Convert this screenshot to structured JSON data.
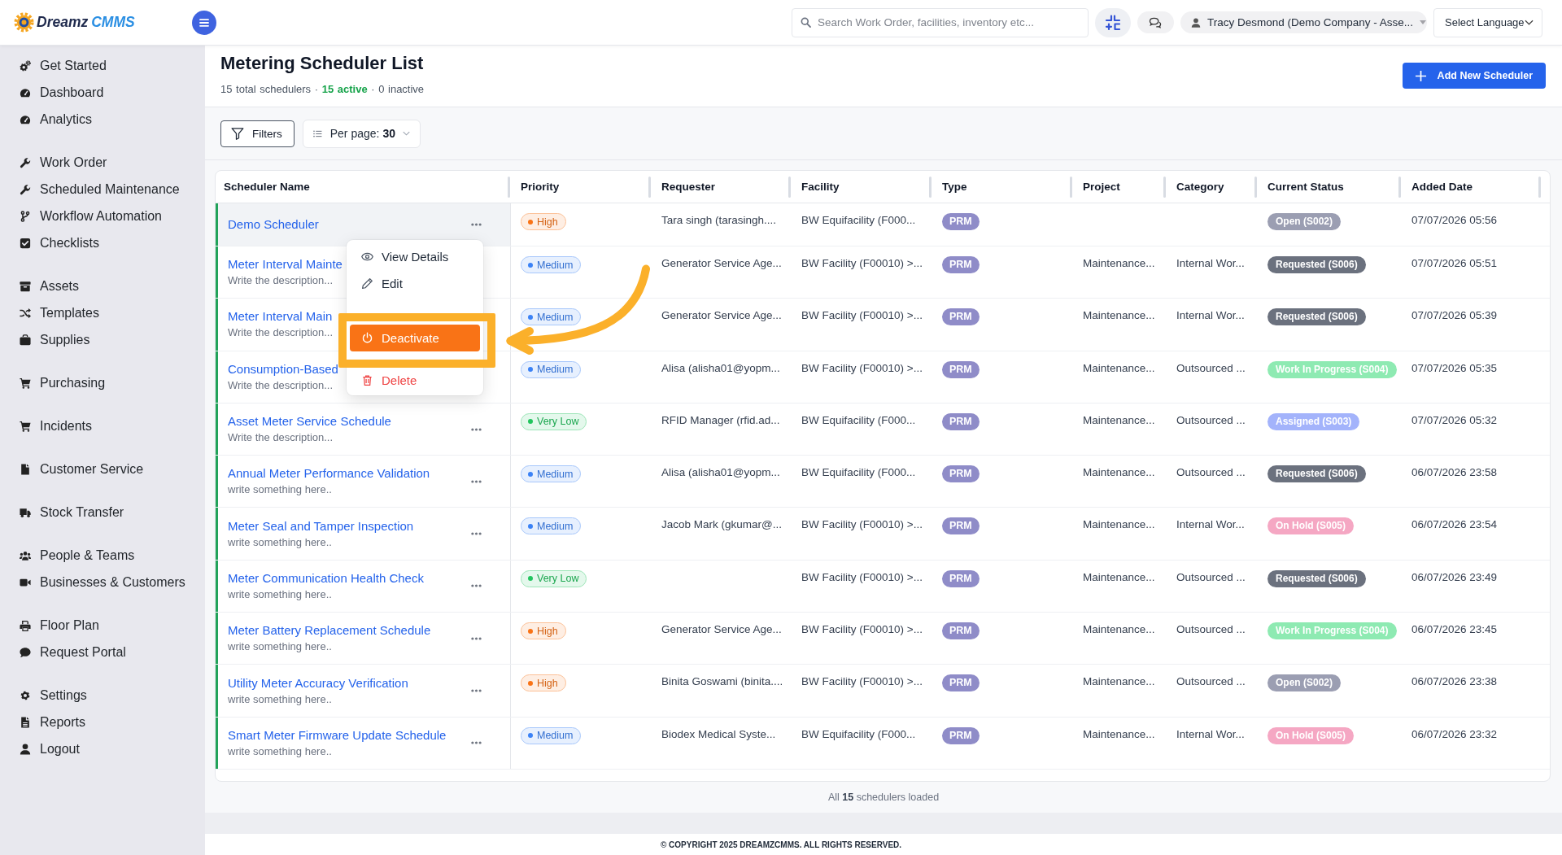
{
  "topbar": {
    "logo": {
      "text": "Dreamz",
      "accent": "CMMS"
    },
    "search": {
      "placeholder": "Search Work Order, facilities, inventory etc..."
    },
    "user": {
      "name": "Tracy Desmond (Demo Company - Asse..."
    },
    "language": {
      "label": "Select Language"
    }
  },
  "sidebar": {
    "groups": [
      {
        "items": [
          {
            "label": "Get Started"
          },
          {
            "label": "Dashboard"
          },
          {
            "label": "Analytics"
          }
        ]
      },
      {
        "items": [
          {
            "label": "Work Order"
          },
          {
            "label": "Scheduled Maintenance"
          },
          {
            "label": "Workflow Automation"
          },
          {
            "label": "Checklists"
          }
        ]
      },
      {
        "items": [
          {
            "label": "Assets"
          },
          {
            "label": "Templates"
          },
          {
            "label": "Supplies"
          }
        ]
      },
      {
        "items": [
          {
            "label": "Purchasing"
          }
        ]
      },
      {
        "items": [
          {
            "label": "Incidents"
          }
        ]
      },
      {
        "items": [
          {
            "label": "Customer Service"
          }
        ]
      },
      {
        "items": [
          {
            "label": "Stock Transfer"
          }
        ]
      },
      {
        "items": [
          {
            "label": "People & Teams"
          },
          {
            "label": "Businesses & Customers"
          }
        ]
      },
      {
        "items": [
          {
            "label": "Floor Plan"
          },
          {
            "label": "Request Portal"
          }
        ]
      },
      {
        "items": [
          {
            "label": "Settings"
          },
          {
            "label": "Reports"
          },
          {
            "label": "Logout"
          }
        ]
      }
    ]
  },
  "page": {
    "title": "Metering Scheduler List",
    "summary": "15 total schedulers · **15 active** · 0 inactive",
    "add_button": "Add New Scheduler"
  },
  "toolbar": {
    "filters": "Filters",
    "per_page": {
      "label": "Per page:",
      "value": "30"
    }
  },
  "table": {
    "columns": [
      "Scheduler Name",
      "Priority",
      "Requester",
      "Facility",
      "Type",
      "Project",
      "Category",
      "Current Status",
      "Added Date"
    ],
    "rows": [
      {
        "name": "Demo Scheduler",
        "active": true,
        "selected": true,
        "more_button": true,
        "priority": {
          "label": "High",
          "color": "#f97316"
        },
        "requester": "Tara singh (tarasingh....",
        "facility": "BW Equifacility (F000...",
        "type": "PRM",
        "status": {
          "label": "Open (S002)",
          "color": "#9b9eb2"
        },
        "added": "07/07/2026 05:56"
      },
      {
        "name": "Meter Interval Mainte",
        "description": "Write the description...",
        "active": true,
        "selected": false,
        "more_button": false,
        "priority": {
          "label": "Medium",
          "color": "#3b82f6"
        },
        "requester": "Generator Service Age...",
        "facility": "BW Facility (F00010) >...",
        "type": "PRM",
        "project": "Maintenance...",
        "category": "Internal Wor...",
        "status": {
          "label": "Requested (S006)",
          "color": "#6b717e"
        },
        "added": "07/07/2026 05:51"
      },
      {
        "name": "Meter Interval Main",
        "description": "Write the description...",
        "active": true,
        "selected": false,
        "more_button": false,
        "priority": {
          "label": "Medium",
          "color": "#3b82f6"
        },
        "requester": "Generator Service Age...",
        "facility": "BW Facility (F00010) >...",
        "type": "PRM",
        "project": "Maintenance...",
        "category": "Internal Wor...",
        "status": {
          "label": "Requested (S006)",
          "color": "#6b717e"
        },
        "added": "07/07/2026 05:39"
      },
      {
        "name": "Consumption-Based",
        "description": "Write the description...",
        "active": true,
        "selected": false,
        "more_button": false,
        "priority": {
          "label": "Medium",
          "color": "#3b82f6"
        },
        "requester": "Alisa (alisha01@yopm...",
        "facility": "BW Facility (F00010) >...",
        "type": "PRM",
        "project": "Maintenance...",
        "category": "Outsourced ...",
        "status": {
          "label": "Work In Progress (S004)",
          "color": "#8eeab2"
        },
        "added": "07/07/2026 05:35"
      },
      {
        "name": "Asset Meter Service Schedule",
        "description": "Write the description...",
        "active": true,
        "selected": false,
        "more_button": true,
        "priority": {
          "label": "Very Low",
          "color": "#22c55e"
        },
        "requester": "RFID Manager (rfid.ad...",
        "facility": "BW Equifacility (F000...",
        "type": "PRM",
        "project": "Maintenance...",
        "category": "Outsourced ...",
        "status": {
          "label": "Assigned (S003)",
          "color": "#a3b3fb"
        },
        "added": "07/07/2026 05:32"
      },
      {
        "name": "Annual Meter Performance Validation",
        "description": "write something here..",
        "active": true,
        "selected": false,
        "more_button": true,
        "priority": {
          "label": "Medium",
          "color": "#3b82f6"
        },
        "requester": "Alisa (alisha01@yopm...",
        "facility": "BW Equifacility (F000...",
        "type": "PRM",
        "project": "Maintenance...",
        "category": "Outsourced ...",
        "status": {
          "label": "Requested (S006)",
          "color": "#6b717e"
        },
        "added": "06/07/2026 23:58"
      },
      {
        "name": "Meter Seal and Tamper Inspection",
        "description": "write something here..",
        "active": true,
        "selected": false,
        "more_button": true,
        "priority": {
          "label": "Medium",
          "color": "#3b82f6"
        },
        "requester": "Jacob Mark (gkumar@...",
        "facility": "BW Facility (F00010) >...",
        "type": "PRM",
        "project": "Maintenance...",
        "category": "Internal Wor...",
        "status": {
          "label": "On Hold (S005)",
          "color": "#f5a7c3"
        },
        "added": "06/07/2026 23:54"
      },
      {
        "name": "Meter Communication Health Check",
        "description": "write something here..",
        "active": true,
        "selected": false,
        "more_button": true,
        "priority": {
          "label": "Very Low",
          "color": "#22c55e"
        },
        "facility": "BW Facility (F00010) >...",
        "type": "PRM",
        "project": "Maintenance...",
        "category": "Outsourced ...",
        "status": {
          "label": "Requested (S006)",
          "color": "#6b717e"
        },
        "added": "06/07/2026 23:49"
      },
      {
        "name": "Meter Battery Replacement Schedule",
        "description": "write something here..",
        "active": true,
        "selected": false,
        "more_button": true,
        "priority": {
          "label": "High",
          "color": "#f97316"
        },
        "requester": "Generator Service Age...",
        "facility": "BW Facility (F00010) >...",
        "type": "PRM",
        "project": "Maintenance...",
        "category": "Outsourced ...",
        "status": {
          "label": "Work In Progress (S004)",
          "color": "#8eeab2"
        },
        "added": "06/07/2026 23:45"
      },
      {
        "name": "Utility Meter Accuracy Verification",
        "description": "write something here..",
        "active": true,
        "selected": false,
        "more_button": true,
        "priority": {
          "label": "High",
          "color": "#f97316"
        },
        "requester": "Binita Goswami (binita....",
        "facility": "BW Facility (F00010) >...",
        "type": "PRM",
        "project": "Maintenance...",
        "category": "Outsourced ...",
        "status": {
          "label": "Open (S002)",
          "color": "#9b9eb2"
        },
        "added": "06/07/2026 23:38"
      },
      {
        "name": "Smart Meter Firmware Update Schedule",
        "description": "write something here..",
        "active": true,
        "selected": false,
        "more_button": true,
        "priority": {
          "label": "Medium",
          "color": "#3b82f6"
        },
        "requester": "Biodex Medical Syste...",
        "facility": "BW Equifacility (F000...",
        "type": "PRM",
        "project": "Maintenance...",
        "category": "Internal Wor...",
        "status": {
          "label": "On Hold (S005)",
          "color": "#f5a7c3"
        },
        "added": "06/07/2026 23:32"
      }
    ],
    "footer": "All **15** schedulers loaded"
  },
  "row_menu": {
    "items": [
      {
        "label": "View Details",
        "kind": "view",
        "selected": false
      },
      {
        "label": "Edit",
        "kind": "edit",
        "selected": false
      },
      {
        "label": "Deactivate",
        "kind": "deactivate",
        "selected": true
      },
      {
        "label": "Delete",
        "kind": "delete",
        "selected": false
      }
    ]
  },
  "copyright": "© COPYRIGHT 2025 DREAMZCMMS. ALL RIGHTS RESERVED."
}
